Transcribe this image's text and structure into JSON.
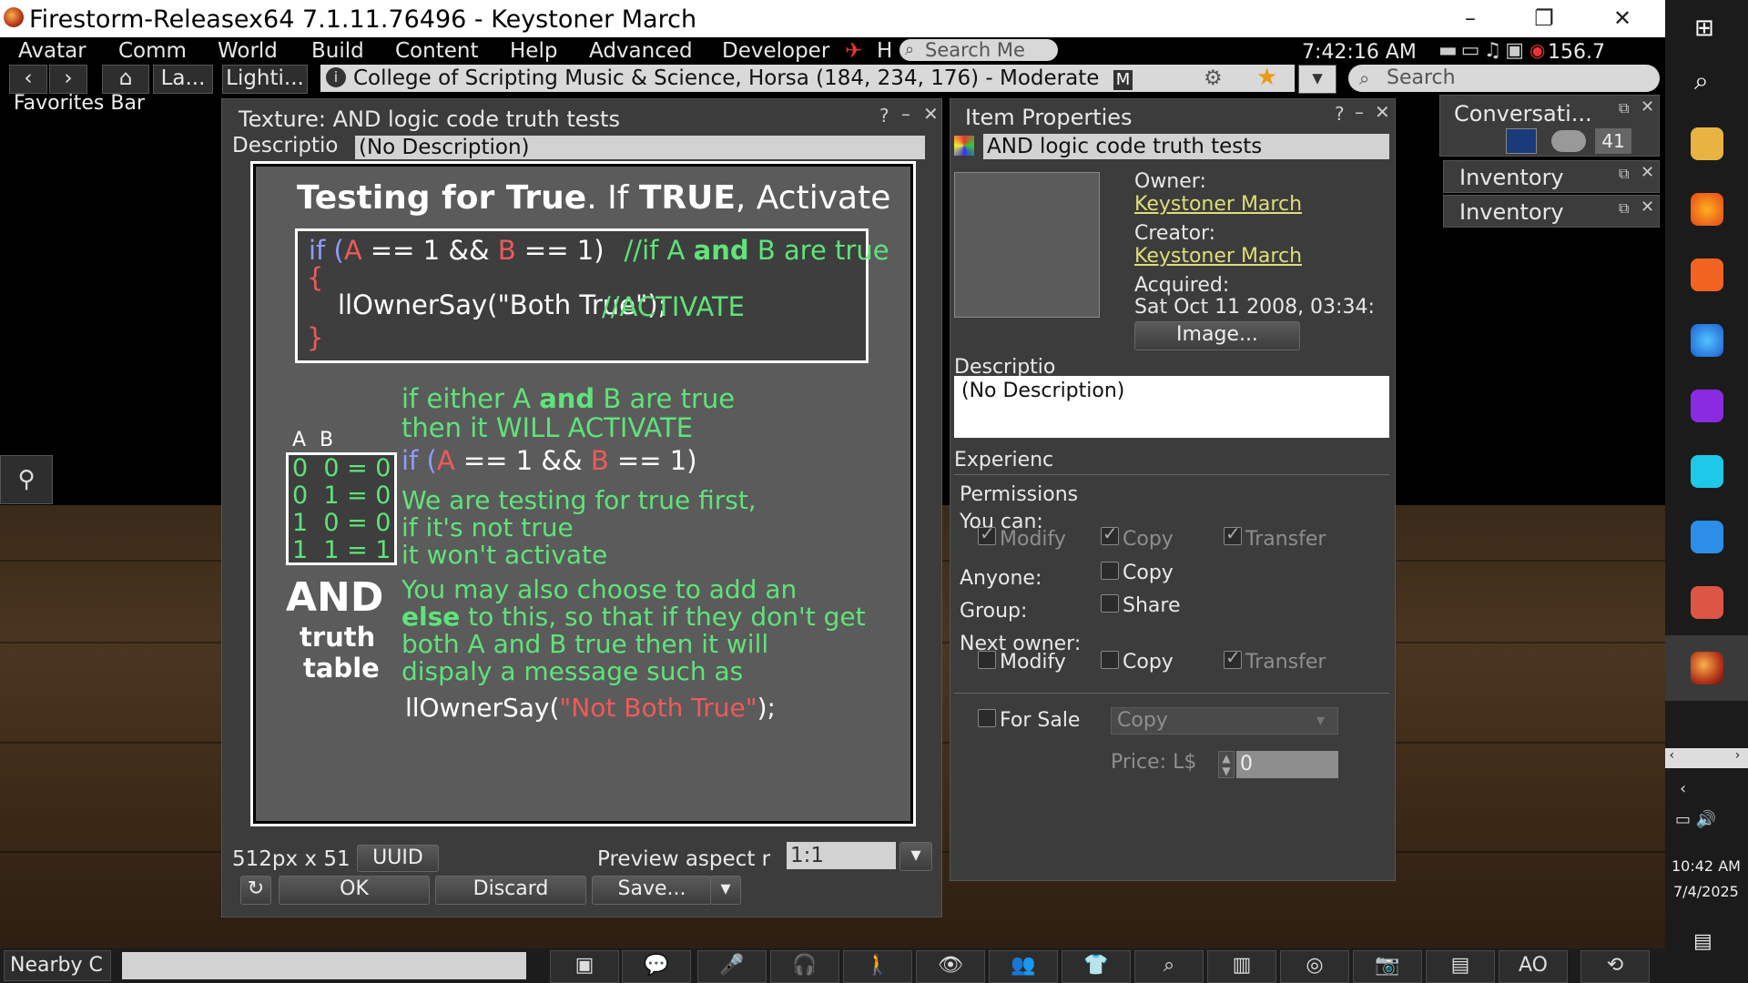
{
  "window": {
    "title": "Firestorm-Releasex64 7.1.11.76496 - Keystoner March"
  },
  "menu": [
    "Avatar",
    "Comm",
    "World",
    "Build",
    "Content",
    "Help",
    "Advanced",
    "Developer"
  ],
  "menu_extra": {
    "h": "H",
    "search_placeholder": "Search Me",
    "time": "7:42:16 AM",
    "fps": "156.7"
  },
  "nav": {
    "land": "La...",
    "light": "Lighti...",
    "location": "College of Scripting Music & Science, Horsa (184, 234, 176) - Moderate",
    "maturity": "M",
    "search_placeholder": "Search"
  },
  "favorites": "Favorites Bar",
  "texture_panel": {
    "title": "Texture: AND logic code truth tests",
    "desc_label": "Descriptio",
    "desc_value": "(No Description)",
    "size": "512px x 51",
    "uuid": "UUID",
    "aspect_label": "Preview aspect r",
    "aspect_value": "1:1",
    "ok": "OK",
    "discard": "Discard",
    "save": "Save..."
  },
  "texture_image": {
    "heading1": "Testing for True",
    "heading2": ". If ",
    "heading3": "TRUE",
    "heading4": ", Activate",
    "line1a": "if (",
    "line1b": "A",
    "line1c": " == 1 && ",
    "line1d": "B",
    "line1e": " == 1)",
    "line1f": "//if A ",
    "line1g": "and",
    "line1h": " B are true",
    "brace_open": "{",
    "say": "llOwnerSay(\"Both True\");",
    "activate": "//ACTIVATE",
    "brace_close": "}",
    "either1a": "if either A ",
    "either1b": "and",
    "either1c": " B are true",
    "either2": "then it WILL ACTIVATE",
    "col_a": "A",
    "col_b": "B",
    "rows": [
      "0  0 = 0",
      "0  1 = 0",
      "1  0 = 0",
      "1  1 = 1"
    ],
    "and": "AND",
    "truth": "truth",
    "table": "table",
    "line2a": "if (",
    "line2b": "A",
    "line2c": " == 1 && ",
    "line2d": "B",
    "line2e": " == 1)",
    "t1": "We are testing for true first,",
    "t2": "if it's not true",
    "t3": "it won't activate",
    "t4": "You may also choose to add an",
    "t5a": "else",
    "t5b": " to this, so that if they don't get",
    "t6": "both A and B true then it will",
    "t7": "dispaly a message such as",
    "say2a": "llOwnerSay(",
    "say2b": "\"Not Both True\"",
    "say2c": ");"
  },
  "item_panel": {
    "title": "Item Properties",
    "name": "AND logic code truth tests",
    "owner_label": "Owner:",
    "owner": "Keystoner March",
    "creator_label": "Creator:",
    "creator": "Keystoner March",
    "acquired_label": "Acquired:",
    "acquired": "Sat Oct 11 2008, 03:34:",
    "image_btn": "Image...",
    "desc_label": "Descriptio",
    "desc_value": "(No Description)",
    "experience": "Experienc",
    "permissions": "Permissions",
    "you_can": "You can:",
    "modify": "Modify",
    "copy": "Copy",
    "transfer": "Transfer",
    "anyone": "Anyone:",
    "group": "Group:",
    "share": "Share",
    "next_owner": "Next owner:",
    "for_sale": "For Sale",
    "sale_type": "Copy",
    "price_label": "Price: L$",
    "price": "0"
  },
  "side_panels": {
    "conversations": "Conversati...",
    "conv_count": "41",
    "inventory1": "Inventory",
    "inventory2": "Inventory"
  },
  "bottom": {
    "nearby": "Nearby C",
    "ao": "AO"
  },
  "taskbar": {
    "time": "10:42 AM",
    "date": "7/4/2025"
  }
}
